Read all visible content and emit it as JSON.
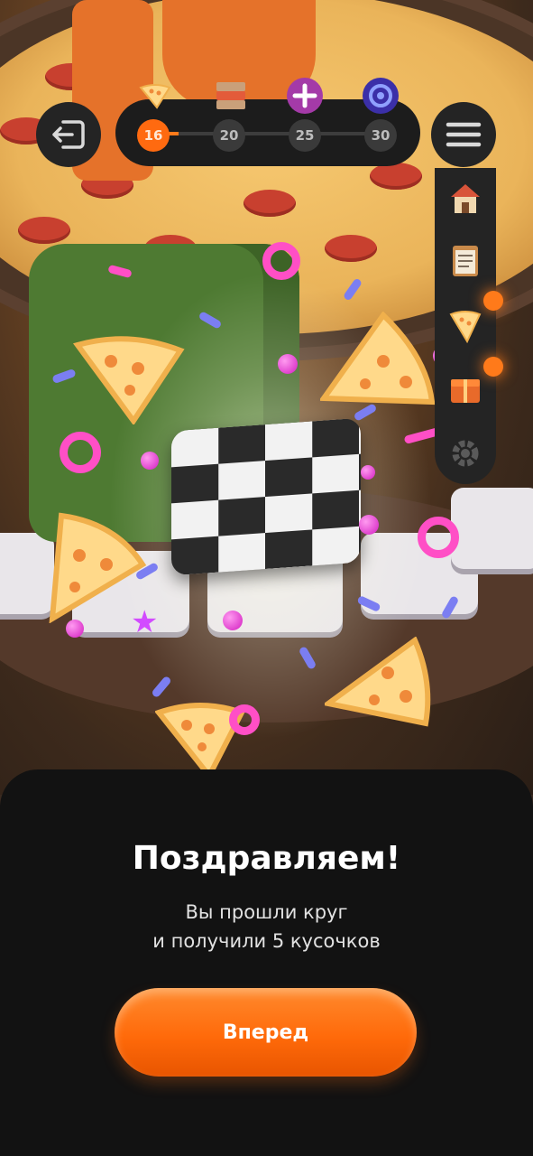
{
  "progress": {
    "current_label": "16",
    "milestones": [
      {
        "label": "16",
        "reward_icon": "pizza-slice-icon"
      },
      {
        "label": "20",
        "reward_icon": "pizza-box-icon"
      },
      {
        "label": "25",
        "reward_icon": "plus-icon"
      },
      {
        "label": "30",
        "reward_icon": "coin-icon"
      }
    ]
  },
  "side_menu": {
    "items": [
      "house-icon",
      "checklist-icon",
      "pizza-slice-icon",
      "gift-icon",
      "gear-icon"
    ]
  },
  "dialog": {
    "title": "Поздравляем!",
    "subtitle_line1": "Вы прошли круг",
    "subtitle_line2": "и получили 5 кусочков",
    "button_label": "Вперед"
  },
  "colors": {
    "accent": "#ff6a10",
    "sheet_bg": "#121212",
    "panel_bg": "#242424"
  }
}
